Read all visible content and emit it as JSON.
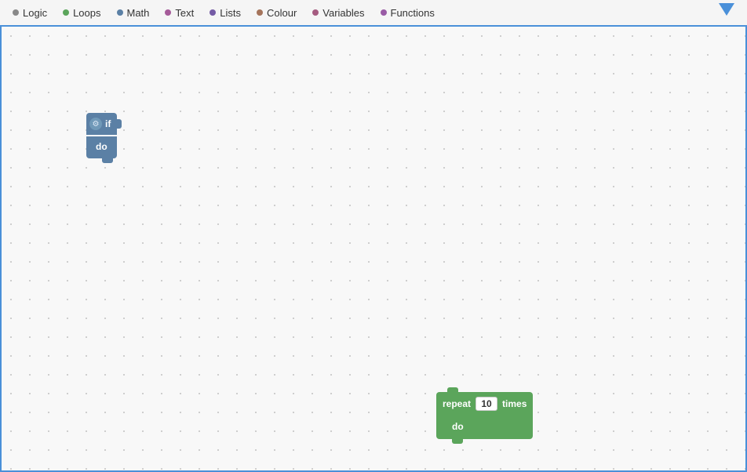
{
  "toolbar": {
    "tabs": [
      {
        "id": "logic",
        "label": "Logic",
        "color": "#888888"
      },
      {
        "id": "loops",
        "label": "Loops",
        "color": "#5ba55b"
      },
      {
        "id": "math",
        "label": "Math",
        "color": "#5b80a5"
      },
      {
        "id": "text",
        "label": "Text",
        "color": "#a55b99"
      },
      {
        "id": "lists",
        "label": "Lists",
        "color": "#745ba5"
      },
      {
        "id": "colour",
        "label": "Colour",
        "color": "#a5745b"
      },
      {
        "id": "variables",
        "label": "Variables",
        "color": "#a55b80"
      },
      {
        "id": "functions",
        "label": "Functions",
        "color": "#995ba5"
      }
    ]
  },
  "blocks": {
    "if_block": {
      "top_label": "if",
      "bottom_label": "do"
    },
    "repeat_block": {
      "top_label_pre": "repeat",
      "top_label_post": "times",
      "number_value": "10",
      "bottom_label": "do"
    }
  }
}
